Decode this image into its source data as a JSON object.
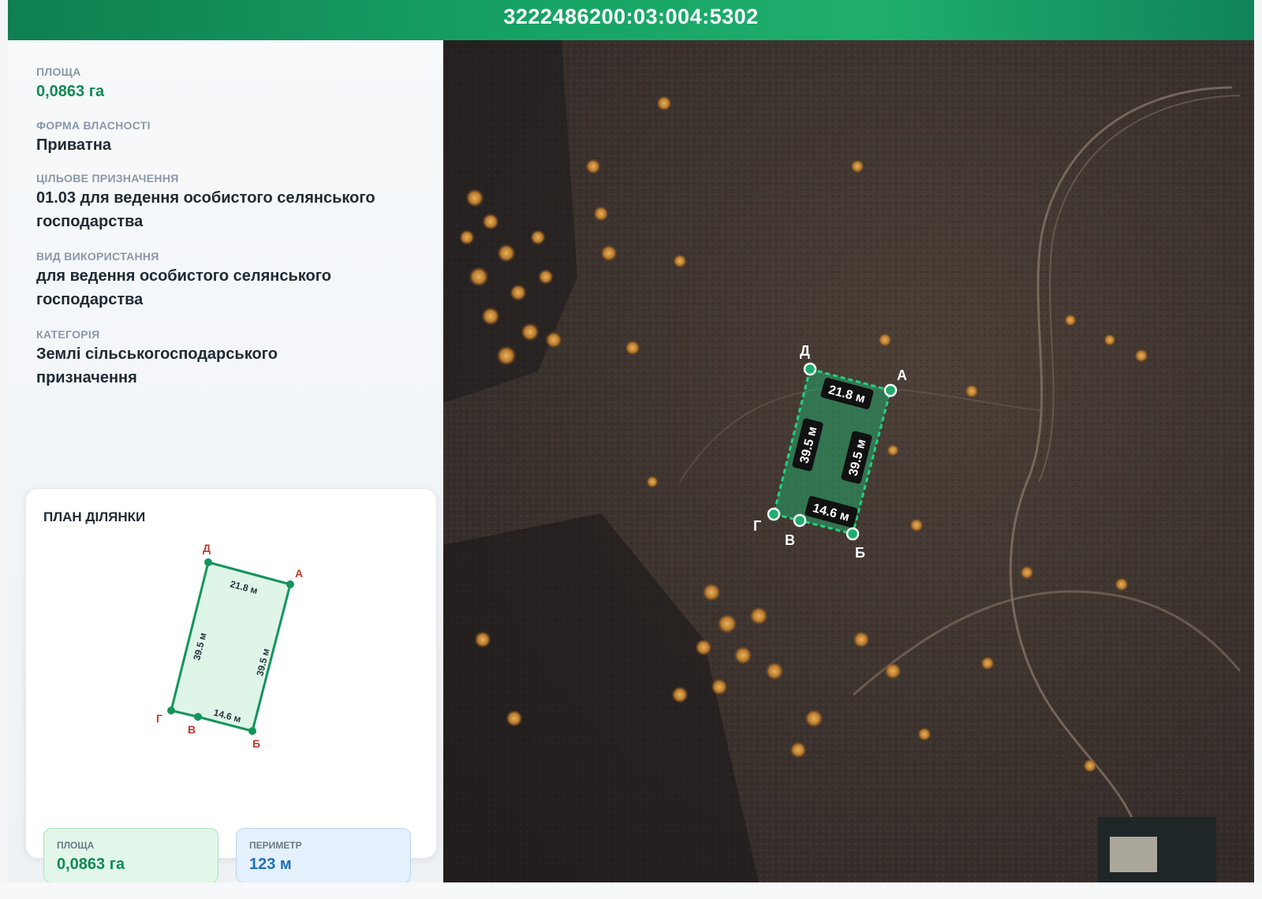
{
  "header": {
    "cadastral_number": "3222486200:03:004:5302"
  },
  "info": {
    "area_label": "ПЛОЩА",
    "area_value": "0,0863 га",
    "ownership_label": "ФОРМА ВЛАСНОСТІ",
    "ownership_value": "Приватна",
    "purpose_label": "ЦІЛЬОВЕ ПРИЗНАЧЕННЯ",
    "purpose_value": "01.03 для ведення особистого селянського господарства",
    "usage_label": "ВИД ВИКОРИСТАННЯ",
    "usage_value": "для ведення особистого селянського господарства",
    "category_label": "КАТЕГОРІЯ",
    "category_value": "Землі сільськогосподарського призначення"
  },
  "plan": {
    "title": "ПЛАН ДІЛЯНКИ",
    "vertices": {
      "a": "А",
      "b": "Б",
      "v": "В",
      "g": "Г",
      "d": "Д"
    },
    "edges": {
      "top": "21.8 м",
      "left": "39.5 м",
      "right": "39.5 м",
      "bottom": "14.6 м"
    },
    "area_label": "ПЛОЩА",
    "area_value": "0,0863 га",
    "perimeter_label": "ПЕРИМЕТР",
    "perimeter_value": "123 м"
  },
  "map": {
    "vertices": {
      "a": "А",
      "b": "Б",
      "v": "В",
      "g": "Г",
      "d": "Д"
    },
    "edges": {
      "top": "21.8 м",
      "left": "39.5 м",
      "right": "39.5 м",
      "bottom": "14.6 м"
    }
  },
  "colors": {
    "accent_green": "#0f8a55",
    "parcel_line": "#1fae6e",
    "vertex_label_red": "#c0392b",
    "perimeter_blue": "#1d6fb8"
  }
}
